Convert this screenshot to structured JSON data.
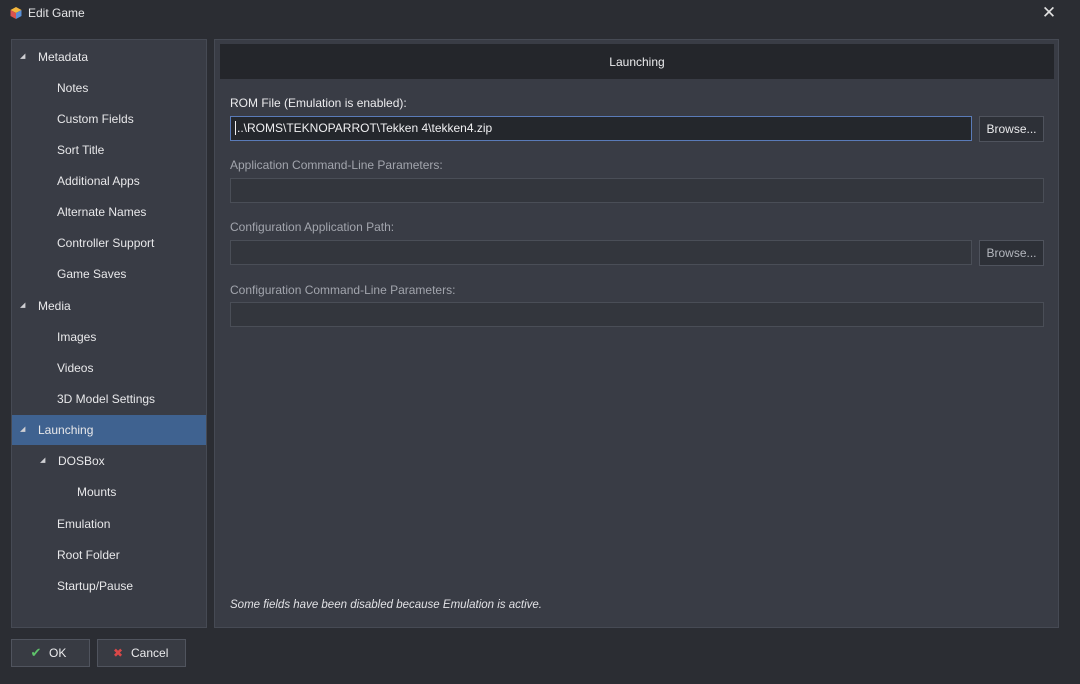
{
  "window": {
    "title": "Edit Game",
    "close_icon": "close-icon",
    "app_icon": "launchbox-app-icon"
  },
  "sidebar": {
    "items": [
      {
        "label": "Metadata",
        "arrow": "◢"
      },
      {
        "label": "Notes"
      },
      {
        "label": "Custom Fields"
      },
      {
        "label": "Sort Title"
      },
      {
        "label": "Additional Apps"
      },
      {
        "label": "Alternate Names"
      },
      {
        "label": "Controller Support"
      },
      {
        "label": "Game Saves"
      },
      {
        "label": "Media",
        "arrow": "◢"
      },
      {
        "label": "Images"
      },
      {
        "label": "Videos"
      },
      {
        "label": "3D Model Settings"
      },
      {
        "label": "Launching",
        "arrow": "◢",
        "selected": true
      },
      {
        "label": "DOSBox",
        "arrow": "◢"
      },
      {
        "label": "Mounts"
      },
      {
        "label": "Emulation"
      },
      {
        "label": "Root Folder"
      },
      {
        "label": "Startup/Pause"
      }
    ]
  },
  "main": {
    "header": "Launching",
    "rom_file": {
      "label": "ROM File (Emulation is enabled):",
      "value": "..\\ROMS\\TEKNOPARROT\\Tekken 4\\tekken4.zip",
      "browse": "Browse..."
    },
    "app_params": {
      "label": "Application Command-Line Parameters:",
      "value": ""
    },
    "config_path": {
      "label": "Configuration Application Path:",
      "value": "",
      "browse": "Browse..."
    },
    "config_params": {
      "label": "Configuration Command-Line Parameters:",
      "value": ""
    },
    "footnote": "Some fields have been disabled because Emulation is active."
  },
  "footer": {
    "ok": "OK",
    "cancel": "Cancel",
    "ok_icon": "checkmark-icon",
    "cancel_icon": "cancel-x-icon"
  },
  "colors": {
    "background": "#2b2d33",
    "panel": "#393c45",
    "selected": "#3f6290",
    "header": "#24262b",
    "focus_border": "#5a7bb8"
  }
}
